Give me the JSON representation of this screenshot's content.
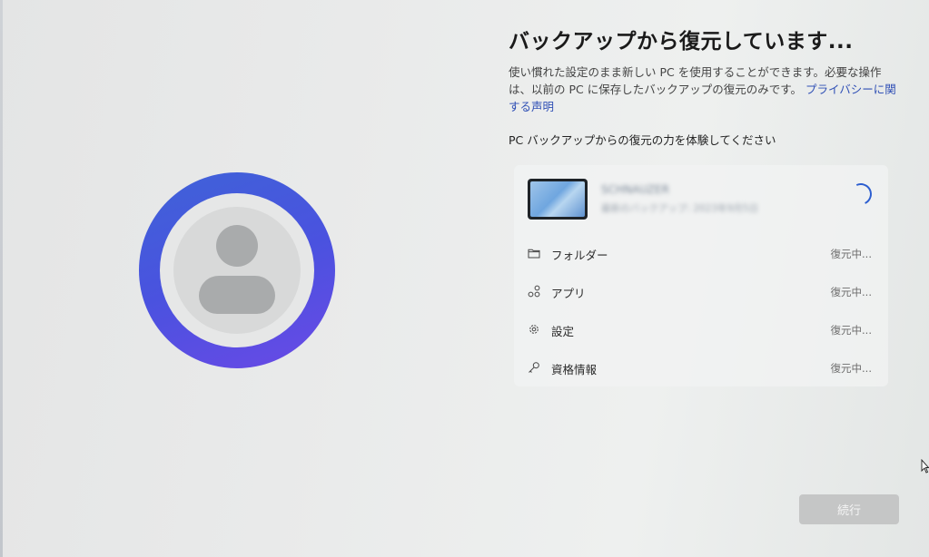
{
  "title": "バックアップから復元しています...",
  "description": {
    "text": "使い慣れた設定のまま新しい PC を使用することができます。必要な操作は、以前の PC に保存したバックアップの復元のみです。",
    "privacy_link": "プライバシーに関する声明"
  },
  "subheading": "PC バックアップからの復元の力を体験してください",
  "device": {
    "name": "SCHNAUZER",
    "subtitle": "最新のバックアップ: 2023年9月5日"
  },
  "restore_items": [
    {
      "label": "フォルダー",
      "status": "復元中...",
      "icon": "folder-icon"
    },
    {
      "label": "アプリ",
      "status": "復元中...",
      "icon": "apps-icon"
    },
    {
      "label": "設定",
      "status": "復元中...",
      "icon": "gear-icon"
    },
    {
      "label": "資格情報",
      "status": "復元中...",
      "icon": "key-icon"
    }
  ],
  "continue_button": "続行",
  "colors": {
    "accent_ring": "#4a52df",
    "link": "#2f4fb5",
    "spinner": "#2d5fd0"
  }
}
